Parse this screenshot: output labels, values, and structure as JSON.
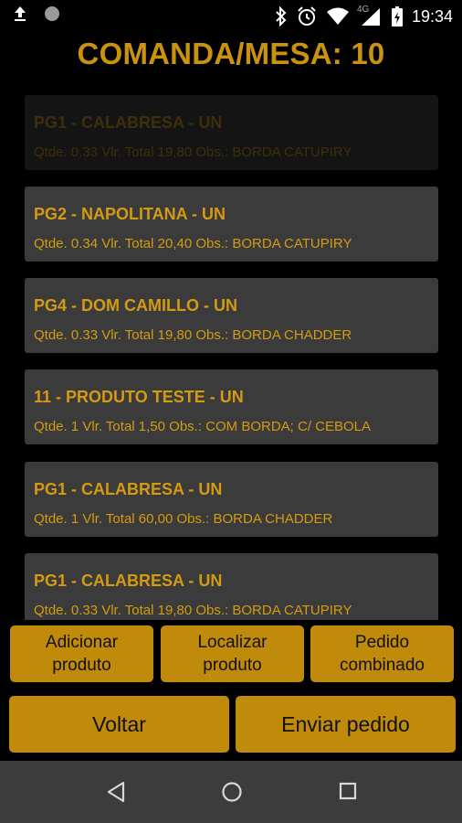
{
  "status_bar": {
    "time": "19:34",
    "network": "4G",
    "icons": [
      "upload-icon",
      "circle-icon",
      "bluetooth-icon",
      "alarm-icon",
      "wifi-icon",
      "signal-icon",
      "battery-icon"
    ]
  },
  "title": "COMANDA/MESA: 10",
  "items": [
    {
      "name": "PG1 - CALABRESA - UN",
      "info": "Qtde. 0.33   Vlr. Total 19,80   Obs.: BORDA CATUPIRY"
    },
    {
      "name": "PG2 - NAPOLITANA - UN",
      "info": "Qtde. 0.34   Vlr. Total 20,40   Obs.: BORDA CATUPIRY"
    },
    {
      "name": "PG4 - DOM CAMILLO - UN",
      "info": "Qtde. 0.33   Vlr. Total 19,80   Obs.: BORDA CHADDER"
    },
    {
      "name": "11 - PRODUTO TESTE - UN",
      "info": "Qtde. 1   Vlr. Total 1,50   Obs.: COM BORDA; C/ CEBOLA"
    },
    {
      "name": "PG1 - CALABRESA - UN",
      "info": "Qtde. 1   Vlr. Total 60,00   Obs.: BORDA CHADDER"
    },
    {
      "name": "PG1 - CALABRESA - UN",
      "info": "Qtde. 0.33   Vlr. Total 19,80   Obs.: BORDA CATUPIRY"
    }
  ],
  "actions": {
    "add_line1": "Adicionar",
    "add_line2": "produto",
    "find_line1": "Localizar",
    "find_line2": "produto",
    "combo_line1": "Pedido",
    "combo_line2": "combinado",
    "back": "Voltar",
    "send": "Enviar pedido"
  },
  "colors": {
    "accent": "#c9930f",
    "button": "#c08a0a",
    "card": "#3b3b3b",
    "background": "#000000",
    "nav_bar": "#3c3c3c"
  }
}
